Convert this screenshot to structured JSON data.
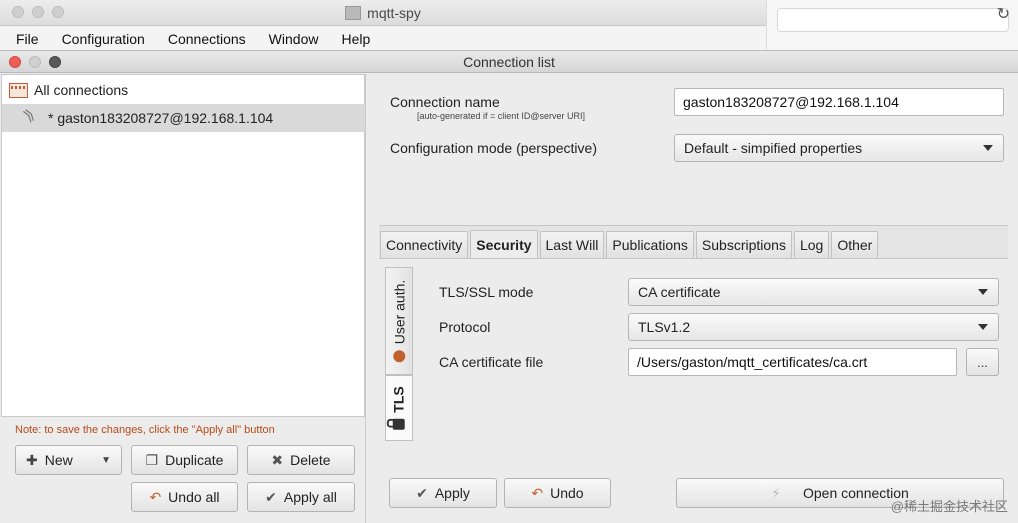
{
  "background_window": {
    "title": "mqtt-spy",
    "menu": [
      "File",
      "Configuration",
      "Connections",
      "Window",
      "Help"
    ]
  },
  "window": {
    "title": "Connection list"
  },
  "tree": {
    "root_label": "All connections",
    "items": [
      {
        "label": "* gaston183208727@192.168.1.104",
        "selected": true
      }
    ]
  },
  "left_footer": {
    "note": "Note: to save the changes, click the \"Apply all\" button",
    "new_label": "New",
    "duplicate_label": "Duplicate",
    "delete_label": "Delete",
    "undo_all_label": "Undo all",
    "apply_all_label": "Apply all"
  },
  "form": {
    "connection_name_label": "Connection name",
    "connection_name_hint": "[auto-generated if = client ID@server URI]",
    "connection_name_value": "gaston183208727@192.168.1.104",
    "config_mode_label": "Configuration mode (perspective)",
    "config_mode_value": "Default - simpified properties"
  },
  "tabs": [
    "Connectivity",
    "Security",
    "Last Will",
    "Publications",
    "Subscriptions",
    "Log",
    "Other"
  ],
  "active_tab": "Security",
  "security": {
    "side_tabs": [
      "User auth.",
      "TLS"
    ],
    "active_side_tab": "TLS",
    "tls_mode_label": "TLS/SSL mode",
    "tls_mode_value": "CA certificate",
    "protocol_label": "Protocol",
    "protocol_value": "TLSv1.2",
    "ca_file_label": "CA certificate file",
    "ca_file_value": "/Users/gaston/mqtt_certificates/ca.crt",
    "browse_label": "..."
  },
  "actions": {
    "apply_label": "Apply",
    "undo_label": "Undo",
    "open_connection_label": "Open connection"
  },
  "watermark": "@稀土掘金技术社区"
}
